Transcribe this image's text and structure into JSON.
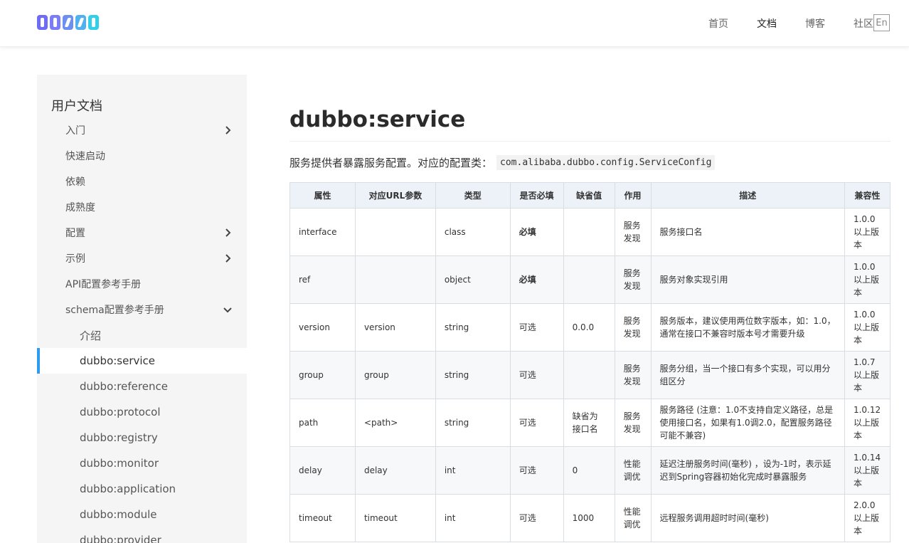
{
  "nav": {
    "items": [
      "首页",
      "文档",
      "博客",
      "社区"
    ],
    "lang": "En"
  },
  "sidebar": {
    "title": "用户文档",
    "items": [
      {
        "label": "入门",
        "chevron": "right"
      },
      {
        "label": "快速启动"
      },
      {
        "label": "依赖"
      },
      {
        "label": "成熟度"
      },
      {
        "label": "配置",
        "chevron": "right"
      },
      {
        "label": "示例",
        "chevron": "right"
      },
      {
        "label": "API配置参考手册"
      },
      {
        "label": "schema配置参考手册",
        "chevron": "down"
      }
    ],
    "subitems": [
      "介绍",
      "dubbo:service",
      "dubbo:reference",
      "dubbo:protocol",
      "dubbo:registry",
      "dubbo:monitor",
      "dubbo:application",
      "dubbo:module",
      "dubbo:provider"
    ]
  },
  "page": {
    "title": "dubbo:service",
    "description": "服务提供者暴露服务配置。对应的配置类：",
    "config_class": "com.alibaba.dubbo.config.ServiceConfig"
  },
  "table": {
    "headers": [
      "属性",
      "对应URL参数",
      "类型",
      "是否必填",
      "缺省值",
      "作用",
      "描述",
      "兼容性"
    ],
    "rows": [
      [
        "interface",
        "",
        "class",
        "必填",
        "",
        "服务发现",
        "服务接口名",
        "1.0.0以上版本"
      ],
      [
        "ref",
        "",
        "object",
        "必填",
        "",
        "服务发现",
        "服务对象实现引用",
        "1.0.0以上版本"
      ],
      [
        "version",
        "version",
        "string",
        "可选",
        "0.0.0",
        "服务发现",
        "服务版本，建议使用两位数字版本，如：1.0，通常在接口不兼容时版本号才需要升级",
        "1.0.0以上版本"
      ],
      [
        "group",
        "group",
        "string",
        "可选",
        "",
        "服务发现",
        "服务分组，当一个接口有多个实现，可以用分组区分",
        "1.0.7以上版本"
      ],
      [
        "path",
        "<path>",
        "string",
        "可选",
        "缺省为接口名",
        "服务发现",
        "服务路径 (注意：1.0不支持自定义路径，总是使用接口名，如果有1.0调2.0，配置服务路径可能不兼容)",
        "1.0.12以上版本"
      ],
      [
        "delay",
        "delay",
        "int",
        "可选",
        "0",
        "性能调优",
        "延迟注册服务时间(毫秒) ，设为-1时，表示延迟到Spring容器初始化完成时暴露服务",
        "1.0.14以上版本"
      ],
      [
        "timeout",
        "timeout",
        "int",
        "可选",
        "1000",
        "性能调优",
        "远程服务调用超时时间(毫秒)",
        "2.0.0以上版本"
      ]
    ]
  }
}
